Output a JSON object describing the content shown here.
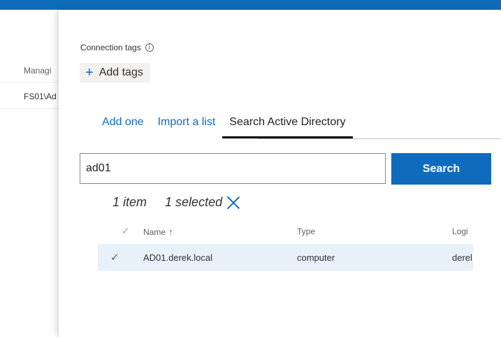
{
  "background": {
    "column_header": "Managi",
    "row_cell": "FS01\\Ad"
  },
  "panel": {
    "connection_tags_label": "Connection tags",
    "info_icon_glyph": "i",
    "add_tags_icon": "+",
    "add_tags_label": "Add tags",
    "tabs": [
      {
        "label": "Add one"
      },
      {
        "label": "Import a list"
      },
      {
        "label": "Search Active Directory"
      }
    ],
    "search": {
      "value": "ad01",
      "button_label": "Search"
    },
    "status": {
      "item_count": "1 item",
      "selected": "1 selected"
    },
    "grid": {
      "headers": {
        "check": "✓",
        "name": "Name",
        "sort_arrow": "↑",
        "type": "Type",
        "login": "Logi"
      },
      "rows": [
        {
          "check": "✓",
          "name": "AD01.derek.local",
          "type": "computer",
          "login": "derel"
        }
      ]
    }
  },
  "colors": {
    "accent": "#0f6cbd",
    "selected_row": "#e8f0f9"
  }
}
